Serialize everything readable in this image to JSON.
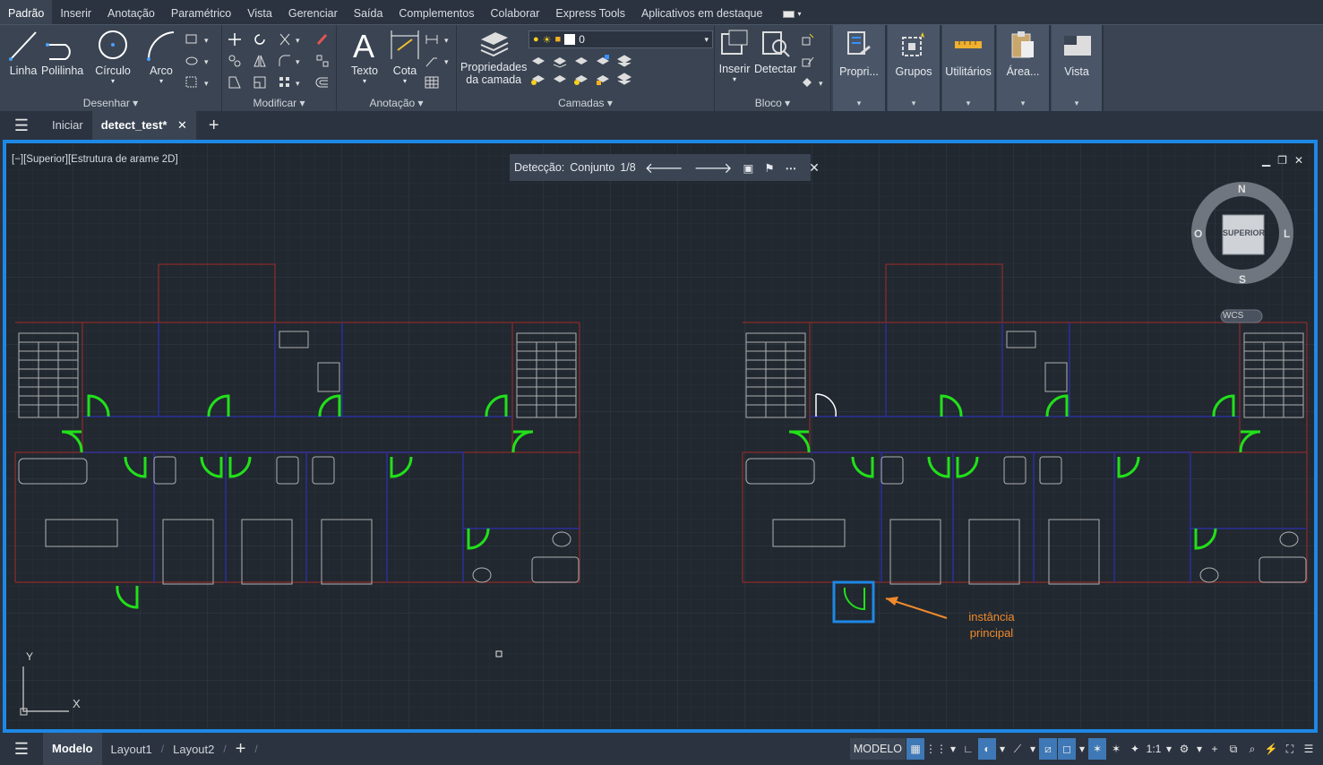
{
  "menubar": {
    "tabs": [
      "Padrão",
      "Inserir",
      "Anotação",
      "Paramétrico",
      "Vista",
      "Gerenciar",
      "Saída",
      "Complementos",
      "Colaborar",
      "Express Tools",
      "Aplicativos em destaque"
    ]
  },
  "ribbon": {
    "draw": {
      "title": "Desenhar",
      "line": "Linha",
      "polyline": "Polilinha",
      "circle": "Círculo",
      "arc": "Arco"
    },
    "modify": {
      "title": "Modificar"
    },
    "annotation": {
      "title": "Anotação",
      "text": "Texto",
      "dimension": "Cota"
    },
    "layers": {
      "title": "Camadas",
      "properties_line1": "Propriedades",
      "properties_line2": "da camada",
      "current_layer": "0"
    },
    "block": {
      "title": "Bloco",
      "insert": "Inserir",
      "detect": "Detectar"
    },
    "properties": {
      "label": "Propri..."
    },
    "groups": {
      "label": "Grupos"
    },
    "utilities": {
      "label": "Utilitários"
    },
    "clipboard": {
      "label": "Área..."
    },
    "view": {
      "label": "Vista"
    }
  },
  "tabs": {
    "home": "Iniciar",
    "file": "detect_test*"
  },
  "viewport": {
    "label": "[−][Superior][Estrutura de arame 2D]",
    "detection": {
      "label": "Detecção:",
      "set": "Conjunto",
      "counter": "1/8"
    },
    "viewcube": {
      "face": "SUPERIOR",
      "n": "N",
      "s": "S",
      "e": "L",
      "w": "O",
      "wcs": "WCS"
    },
    "ucs": {
      "y": "Y",
      "x": "X"
    },
    "annotation": {
      "line1": "instância",
      "line2": "principal"
    }
  },
  "statusbar": {
    "tabs": [
      "Modelo",
      "Layout1",
      "Layout2"
    ],
    "model": "MODELO",
    "scale": "1:1"
  },
  "colors": {
    "accent": "#1e88e5",
    "door": "#22e01a",
    "wall": "#7a2a2a",
    "partition": "#2a2f9a",
    "annotation": "#f08a2a"
  }
}
